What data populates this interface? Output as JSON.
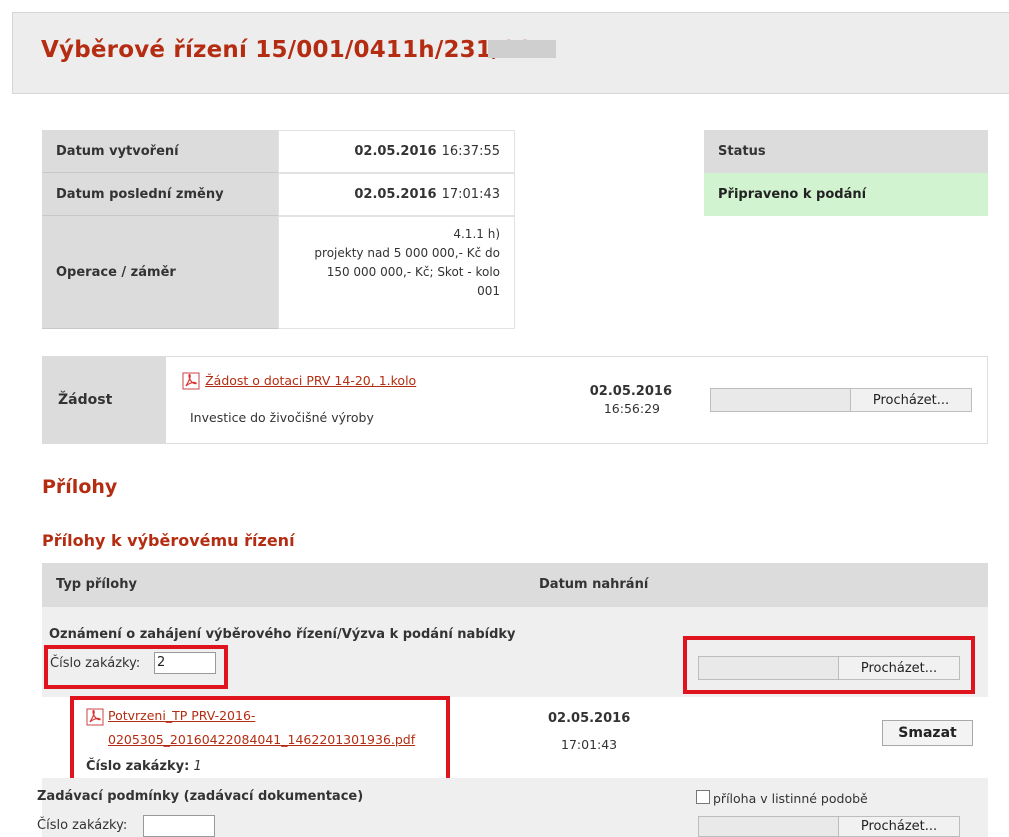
{
  "page": {
    "title": "Výběrové řízení 15/001/0411h/231/00"
  },
  "info": {
    "created_label": "Datum vytvoření",
    "created_date": "02.05.2016",
    "created_time": "16:37:55",
    "modified_label": "Datum poslední změny",
    "modified_date": "02.05.2016",
    "modified_time": "17:01:43",
    "operation_label": "Operace / záměr",
    "operation_lines": [
      "4.1.1 h)",
      "projekty nad 5 000 000,- Kč do",
      "150 000 000,- Kč; Skot - kolo",
      "001"
    ]
  },
  "status": {
    "label": "Status",
    "value": "Připraveno k podání",
    "color": "#d1f3cf"
  },
  "zadost": {
    "label": "Žádost",
    "link": "Žádost o dotaci PRV 14-20, 1.kolo",
    "description": "Investice do živočišné výroby",
    "date": "02.05.2016",
    "time": "16:56:29",
    "browse_label": "Procházet..."
  },
  "attachments": {
    "heading": "Přílohy",
    "subheading": "Přílohy k výběrovému řízení",
    "col_type": "Typ přílohy",
    "col_date": "Datum nahrání",
    "item1": {
      "title": "Oznámení o zahájení výběrového řízení/Výzva k podání nabídky",
      "order_label": "Číslo zakázky:",
      "order_value": "2",
      "browse_label": "Procházet...",
      "file_line1": "Potvrzeni_TP PRV-2016-",
      "file_line2": "0205305_20160422084041_1462201301936.pdf",
      "file_date": "02.05.2016",
      "file_time": "17:01:43",
      "file_order_label": "Číslo zakázky:",
      "file_order_value": "1",
      "delete_label": "Smazat"
    },
    "item2": {
      "title": "Zadávací podmínky (zadávací dokumentace)",
      "paper_label": "příloha v listinné podobě",
      "order_label": "Číslo zakázky:",
      "order_value": "",
      "browse_label": "Procházet..."
    }
  },
  "colors": {
    "accent": "#b42d12",
    "highlight": "#e0141f"
  }
}
